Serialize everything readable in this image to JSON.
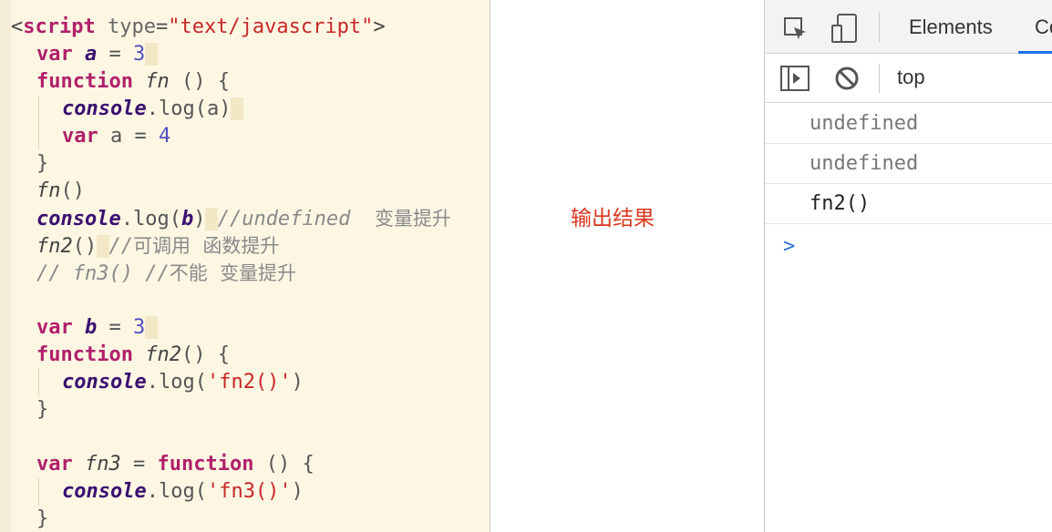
{
  "editor": {
    "lines": [
      {
        "segs": [
          {
            "t": "<",
            "c": "tag"
          },
          {
            "t": "script",
            "c": "kw"
          },
          {
            "t": " type",
            "c": "attr"
          },
          {
            "t": "=",
            "c": "plain"
          },
          {
            "t": "\"text/javascript\"",
            "c": "str"
          },
          {
            "t": ">",
            "c": "tag"
          }
        ]
      },
      {
        "indent": 1,
        "segs": [
          {
            "t": "var",
            "c": "kw"
          },
          {
            "t": " ",
            "c": "plain"
          },
          {
            "t": "a",
            "c": "boldi"
          },
          {
            "t": " = ",
            "c": "plain"
          },
          {
            "t": "3",
            "c": "num"
          },
          {
            "t": " ",
            "c": "hl"
          }
        ]
      },
      {
        "indent": 1,
        "segs": [
          {
            "t": "function",
            "c": "kw"
          },
          {
            "t": " ",
            "c": "plain"
          },
          {
            "t": "fn",
            "c": "fn"
          },
          {
            "t": " () {",
            "c": "plain"
          }
        ]
      },
      {
        "indent": 2,
        "segs": [
          {
            "t": "console",
            "c": "boldi"
          },
          {
            "t": ".log(a)",
            "c": "plain"
          },
          {
            "t": " ",
            "c": "hl"
          }
        ]
      },
      {
        "indent": 2,
        "segs": [
          {
            "t": "var",
            "c": "kw"
          },
          {
            "t": " a = ",
            "c": "plain"
          },
          {
            "t": "4",
            "c": "num"
          }
        ]
      },
      {
        "indent": 1,
        "segs": [
          {
            "t": "}",
            "c": "plain"
          }
        ]
      },
      {
        "indent": 1,
        "segs": [
          {
            "t": "fn",
            "c": "fn"
          },
          {
            "t": "()",
            "c": "plain"
          }
        ]
      },
      {
        "indent": 1,
        "segs": [
          {
            "t": "console",
            "c": "boldi"
          },
          {
            "t": ".log(",
            "c": "plain"
          },
          {
            "t": "b",
            "c": "boldi"
          },
          {
            "t": ")",
            "c": "plain"
          },
          {
            "t": " ",
            "c": "hl"
          },
          {
            "t": "//undefined  ",
            "c": "cmt"
          },
          {
            "t": "变量提升",
            "c": "cmt-cjk"
          }
        ]
      },
      {
        "indent": 1,
        "segs": [
          {
            "t": "fn2",
            "c": "fn"
          },
          {
            "t": "()",
            "c": "plain"
          },
          {
            "t": " ",
            "c": "hl"
          },
          {
            "t": "//",
            "c": "cmt"
          },
          {
            "t": "可调用  函数提升",
            "c": "cmt-cjk"
          }
        ]
      },
      {
        "indent": 1,
        "segs": [
          {
            "t": "// fn3() //",
            "c": "cmt"
          },
          {
            "t": "不能  变量提升",
            "c": "cmt-cjk"
          }
        ]
      },
      {
        "indent": 0,
        "segs": [
          {
            "t": "",
            "c": "plain"
          }
        ]
      },
      {
        "indent": 1,
        "segs": [
          {
            "t": "var",
            "c": "kw"
          },
          {
            "t": " ",
            "c": "plain"
          },
          {
            "t": "b",
            "c": "boldi"
          },
          {
            "t": " = ",
            "c": "plain"
          },
          {
            "t": "3",
            "c": "num"
          },
          {
            "t": " ",
            "c": "hl"
          }
        ]
      },
      {
        "indent": 1,
        "segs": [
          {
            "t": "function",
            "c": "kw"
          },
          {
            "t": " ",
            "c": "plain"
          },
          {
            "t": "fn2",
            "c": "fn"
          },
          {
            "t": "() {",
            "c": "plain"
          }
        ]
      },
      {
        "indent": 2,
        "segs": [
          {
            "t": "console",
            "c": "boldi"
          },
          {
            "t": ".log(",
            "c": "plain"
          },
          {
            "t": "'fn2()'",
            "c": "str"
          },
          {
            "t": ")",
            "c": "plain"
          }
        ]
      },
      {
        "indent": 1,
        "segs": [
          {
            "t": "}",
            "c": "plain"
          }
        ]
      },
      {
        "indent": 0,
        "segs": [
          {
            "t": "",
            "c": "plain"
          }
        ]
      },
      {
        "indent": 1,
        "segs": [
          {
            "t": "var",
            "c": "kw"
          },
          {
            "t": " ",
            "c": "plain"
          },
          {
            "t": "fn3",
            "c": "fn"
          },
          {
            "t": " = ",
            "c": "plain"
          },
          {
            "t": "function",
            "c": "kw"
          },
          {
            "t": " () {",
            "c": "plain"
          }
        ]
      },
      {
        "indent": 2,
        "segs": [
          {
            "t": "console",
            "c": "boldi"
          },
          {
            "t": ".log(",
            "c": "plain"
          },
          {
            "t": "'fn3()'",
            "c": "str"
          },
          {
            "t": ")",
            "c": "plain"
          }
        ]
      },
      {
        "indent": 1,
        "segs": [
          {
            "t": "}",
            "c": "plain"
          }
        ]
      }
    ]
  },
  "page": {
    "result_text": "输出结果"
  },
  "devtools": {
    "tabs": {
      "elements": "Elements",
      "console_partial": "Co"
    },
    "context": "top",
    "console_lines": [
      {
        "text": "undefined",
        "style": "muted"
      },
      {
        "text": "undefined",
        "style": "muted"
      },
      {
        "text": "fn2()",
        "style": "dark"
      }
    ],
    "prompt": ">",
    "colors": {
      "accent": "#1a73e8",
      "prompt": "#2a6fd6",
      "result": "#d8381f"
    }
  }
}
